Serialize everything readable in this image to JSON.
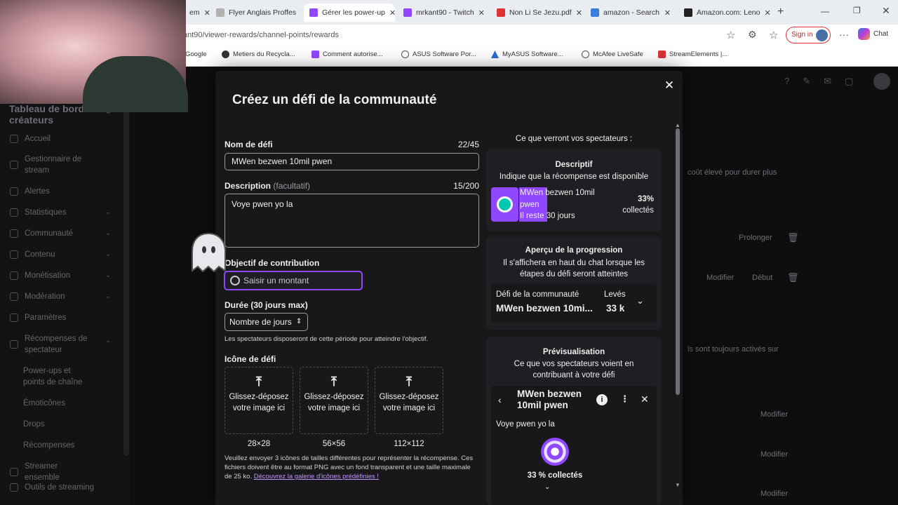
{
  "browser": {
    "tabs": [
      {
        "label": "em",
        "icon_color": "#2b6cd4"
      },
      {
        "label": "Flyer Anglais Proffes",
        "icon_color": "#b0b0b0"
      },
      {
        "label": "Gérer les power-up",
        "icon_color": "#9147ff",
        "active": true
      },
      {
        "label": "mrkant90 - Twitch",
        "icon_color": "#9147ff"
      },
      {
        "label": "Non Li Se Jezu.pdf",
        "icon_color": "#d33"
      },
      {
        "label": "amazon - Search",
        "icon_color": "#3b7ddd"
      },
      {
        "label": "Amazon.com: Leno",
        "icon_color": "#222"
      }
    ],
    "url": "ant90/viewer-rewards/channel-points/rewards",
    "sign_in": "Sign in",
    "chat": "Chat",
    "favorites": [
      {
        "label": "Google"
      },
      {
        "label": "Metiers du Recycla..."
      },
      {
        "label": "Comment autorise..."
      },
      {
        "label": "ASUS Software Por..."
      },
      {
        "label": "MyASUS Software..."
      },
      {
        "label": "McAfee LiveSafe"
      },
      {
        "label": "StreamElements |..."
      }
    ]
  },
  "sidebar": {
    "title": "Tableau de bord des créateurs",
    "items": [
      {
        "label": "Accueil"
      },
      {
        "label": "Gestionnaire de stream"
      },
      {
        "label": "Alertes"
      },
      {
        "label": "Statistiques"
      },
      {
        "label": "Communauté"
      },
      {
        "label": "Contenu"
      },
      {
        "label": "Monétisation"
      },
      {
        "label": "Modération"
      },
      {
        "label": "Paramètres"
      },
      {
        "label": "Récompenses de spectateur"
      },
      {
        "label": "Power-ups et points de chaîne"
      },
      {
        "label": "Émoticônes"
      },
      {
        "label": "Drops"
      },
      {
        "label": "Récompenses"
      },
      {
        "label": "Streamer ensemble"
      },
      {
        "label": "Outils de streaming"
      }
    ]
  },
  "background": {
    "text1": "coût élevé pour durer plus",
    "prolonger": "Prolonger",
    "modifier": "Modifier",
    "debut": "Début",
    "text2": "ls sont toujours activés sur"
  },
  "modal": {
    "title": "Créez un défi de la communauté",
    "name_label": "Nom de défi",
    "name_count": "22/45",
    "name_value": "MWen bezwen 10mil pwen",
    "desc_label": "Description",
    "desc_optional": "(facultatif)",
    "desc_count": "15/200",
    "desc_value": "Voye pwen yo la",
    "goal_label": "Objectif de contribution",
    "goal_placeholder": "Saisir un montant",
    "duration_label": "Durée (30 jours max)",
    "duration_value": "Nombre de jours",
    "duration_note": "Les spectateurs disposeront de cette période pour atteindre l'objectif.",
    "icon_label": "Icône de défi",
    "drop_text": "Glissez-déposez votre image ici",
    "sizes": [
      "28×28",
      "56×56",
      "112×112"
    ],
    "icon_note": "Veuillez envoyer 3 icônes de tailles différentes pour représenter la récompense. Ces fichiers doivent être au format PNG avec un fond transparent et une taille maximale de 25 ko.",
    "icon_link": "Découvrez la galerie d'icônes prédéfinies !"
  },
  "preview": {
    "heading": "Ce que verront vos spectateurs :",
    "desc_title": "Descriptif",
    "desc_sub": "Indique que la récompense est disponible",
    "reward_name": "MWen bezwen 10mil pwen",
    "remaining": "Il reste 30 jours",
    "percent": "33%",
    "collected": "collectés",
    "progress_title": "Aperçu de la progression",
    "progress_sub": "Il s'affichera en haut du chat lorsque les étapes du défi seront atteintes",
    "challenge_label": "Défi de la communauté",
    "raised_label": "Levés",
    "challenge_name": "MWen bezwen 10mi...",
    "raised_value": "33 k",
    "preview_title": "Prévisualisation",
    "preview_sub": "Ce que vos spectateurs voient en contribuant à votre défi",
    "popup_title": "MWen bezwen 10mil pwen",
    "popup_desc": "Voye pwen yo la",
    "popup_percent": "33 % collectés"
  }
}
